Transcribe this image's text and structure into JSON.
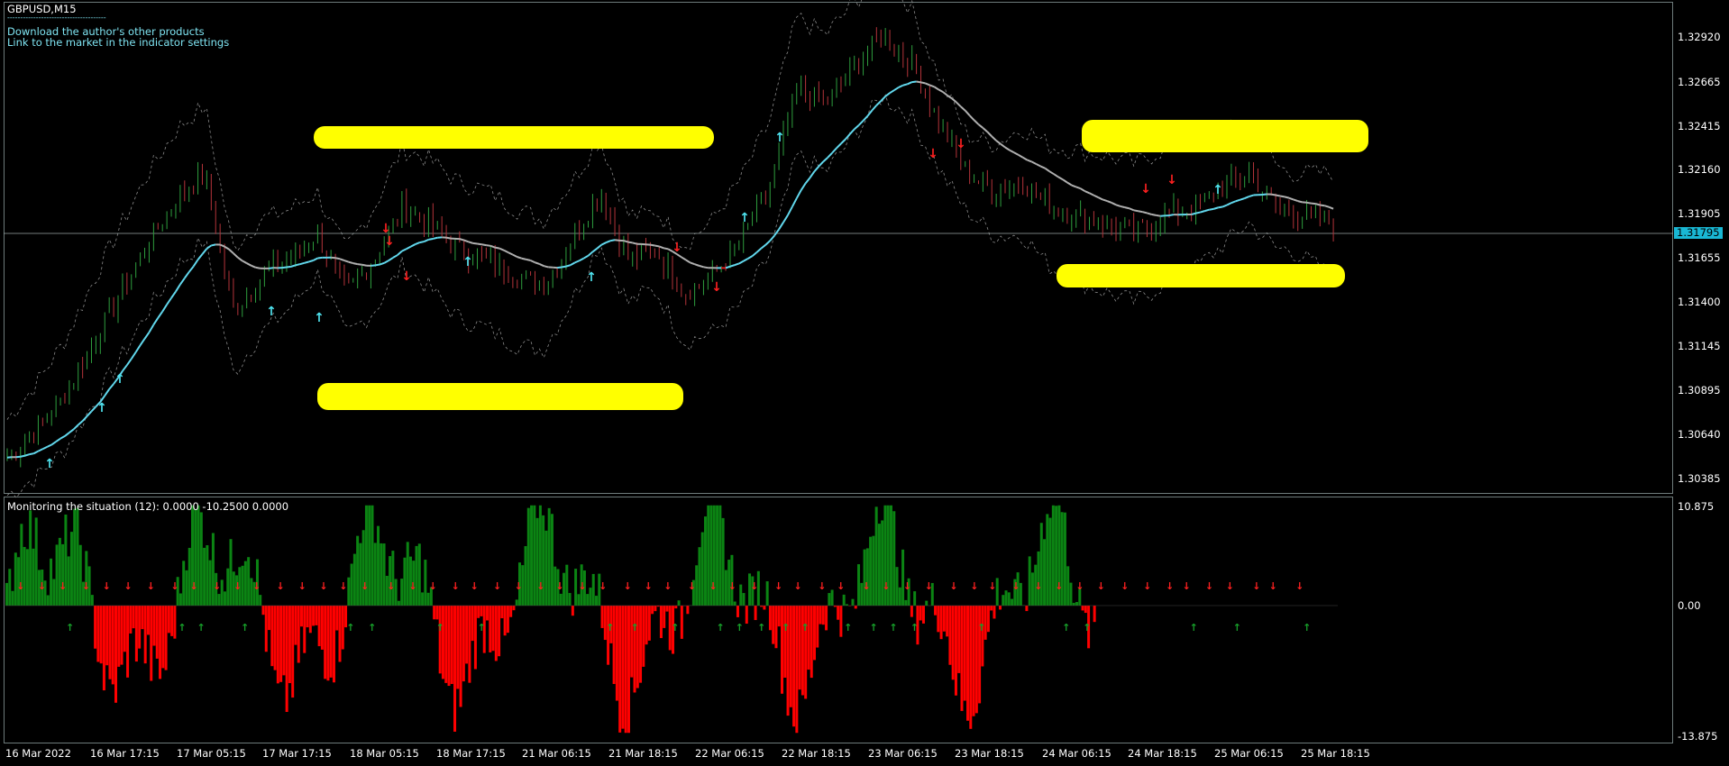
{
  "chart": {
    "symbol": "GBPUSD,M15",
    "separator": "--------------------------------------",
    "notes": [
      "Download the author's other products",
      "Link to the market in the indicator settings"
    ],
    "current_price": "1.31795",
    "y_labels": [
      "1.32920",
      "1.32665",
      "1.32415",
      "1.32160",
      "1.31905",
      "1.31655",
      "1.31400",
      "1.31145",
      "1.30895",
      "1.30640",
      "1.30385"
    ]
  },
  "indicator": {
    "title": "Monitoring the situation (12): 0.0000 -10.2500 0.0000",
    "y_labels": [
      "10.875",
      "0.00",
      "-13.875"
    ]
  },
  "x_labels": [
    "16 Mar 2022",
    "16 Mar 17:15",
    "17 Mar 05:15",
    "17 Mar 17:15",
    "18 Mar 05:15",
    "18 Mar 17:15",
    "21 Mar 06:15",
    "21 Mar 18:15",
    "22 Mar 06:15",
    "22 Mar 18:15",
    "23 Mar 06:15",
    "23 Mar 18:15",
    "24 Mar 06:15",
    "24 Mar 18:15",
    "25 Mar 06:15",
    "25 Mar 18:15"
  ],
  "chart_data": {
    "type": "line",
    "series": [
      {
        "values": [
          1.3045,
          1.306,
          1.308,
          1.311,
          1.314,
          1.317,
          1.3195,
          1.321,
          1.313,
          1.315,
          1.316,
          1.3175,
          1.314,
          1.316,
          1.319,
          1.318,
          1.3165,
          1.316,
          1.315,
          1.3145,
          1.317,
          1.32,
          1.316,
          1.3165,
          1.314,
          1.315,
          1.317,
          1.32,
          1.326,
          1.325,
          1.327,
          1.329,
          1.3275,
          1.324,
          1.321,
          1.32,
          1.3205,
          1.319,
          1.3185,
          1.318,
          1.3175,
          1.3185,
          1.319,
          1.32,
          1.321,
          1.319,
          1.3185,
          1.318
        ]
      }
    ],
    "colors": {
      "bull": "#2e9e3e",
      "bear": "#b4333a",
      "ma_up": "#62d9ee",
      "ma_down": "#e21a1a",
      "highlight": "#ffff00",
      "hist_up": "#0b8413",
      "hist_down": "#ff0000"
    }
  }
}
